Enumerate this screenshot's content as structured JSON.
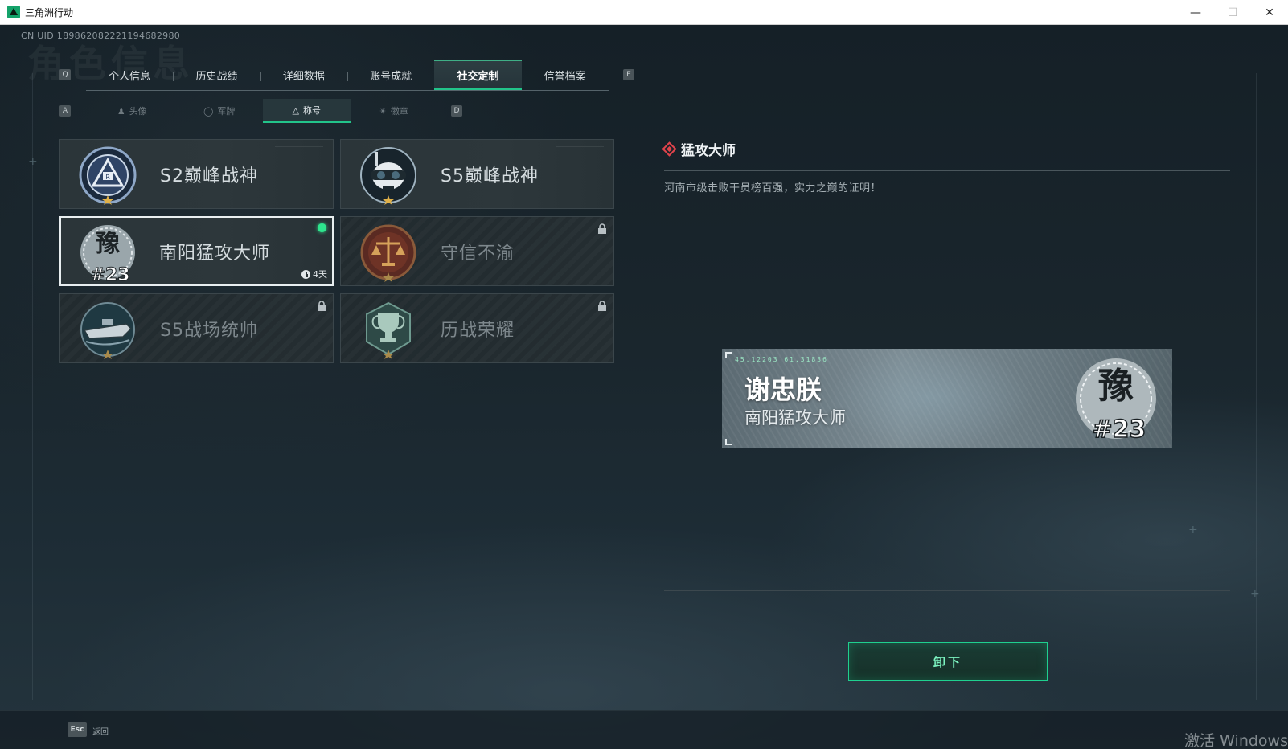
{
  "window": {
    "title": "三角洲行动",
    "minimize": "—",
    "maximize": "☐",
    "close": "✕"
  },
  "header": {
    "uid": "CN UID 1898620822211946829​80",
    "watermark": "角色信息",
    "key_prev": "Q",
    "key_next": "E",
    "sub_key_prev": "A",
    "sub_key_next": "D"
  },
  "main_tabs": [
    {
      "label": "个人信息"
    },
    {
      "label": "历史战绩"
    },
    {
      "label": "详细数据"
    },
    {
      "label": "账号成就"
    },
    {
      "label": "社交定制",
      "active": true
    },
    {
      "label": "信誉档案"
    }
  ],
  "sub_tabs": [
    {
      "label": "头像",
      "icon": "person-icon"
    },
    {
      "label": "军牌",
      "icon": "dogtag-icon"
    },
    {
      "label": "称号",
      "icon": "triangle-icon",
      "active": true
    },
    {
      "label": "徽章",
      "icon": "badge-icon"
    }
  ],
  "titles": [
    {
      "name": "S2巅峰战神",
      "emblem": "s2-emblem-icon",
      "locked": false
    },
    {
      "name": "S5巅峰战神",
      "emblem": "s5-skull-emblem-icon",
      "locked": false
    },
    {
      "name": "南阳猛攻大师",
      "emblem": "yu-23-emblem-icon",
      "locked": false,
      "selected": true,
      "equipped": true,
      "timer": "4天"
    },
    {
      "name": "守信不渝",
      "emblem": "scales-emblem-icon",
      "locked": true
    },
    {
      "name": "S5战场统帅",
      "emblem": "boat-emblem-icon",
      "locked": true
    },
    {
      "name": "历战荣耀",
      "emblem": "trophy-emblem-icon",
      "locked": true
    }
  ],
  "detail": {
    "title": "猛攻大师",
    "description": "河南市级击败干员榜百强，实力之巅的证明！"
  },
  "nameplate": {
    "coords": "45.12203  61.31836",
    "player_name": "谢忠朕",
    "title": "南阳猛攻大师",
    "badge_char": "豫",
    "badge_rank": "#23"
  },
  "actions": {
    "unequip": "卸下",
    "esc_key": "Esc",
    "back": "返回"
  },
  "system": {
    "activate": "激活 Windows"
  },
  "colors": {
    "accent_green": "#22c48a",
    "equipped_dot": "#2ee68e",
    "detail_diamond": "#e0434b"
  }
}
